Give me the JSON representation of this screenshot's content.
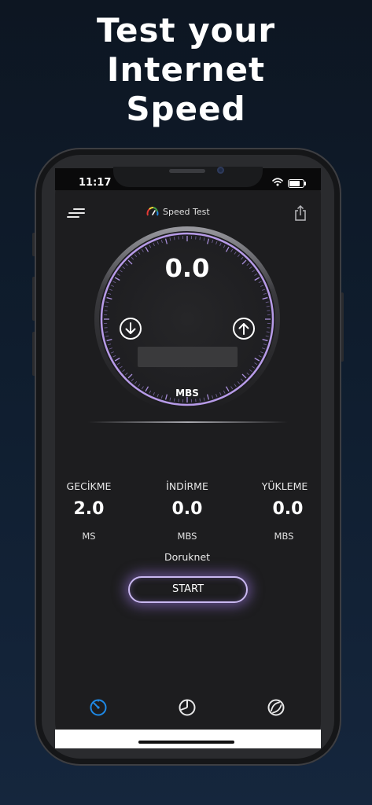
{
  "promo": {
    "line1": "Test your",
    "line2": "Internet",
    "line3": "Speed"
  },
  "status_bar": {
    "time": "11:17",
    "battery_level": 0.85
  },
  "header": {
    "title": "Speed Test",
    "menu_icon": "menu-lines-icon",
    "share_icon": "share-icon"
  },
  "gauge": {
    "speed_value": "0.0",
    "unit": "MBS",
    "download_icon": "arrow-down-circle-icon",
    "upload_icon": "arrow-up-circle-icon"
  },
  "stats": [
    {
      "label": "GECİKME",
      "value": "2.0",
      "unit": "MS"
    },
    {
      "label": "İNDİRME",
      "value": "0.0",
      "unit": "MBS"
    },
    {
      "label": "YÜKLEME",
      "value": "0.0",
      "unit": "MBS"
    }
  ],
  "provider": "Doruknet",
  "start_label": "START",
  "tabs": [
    {
      "icon": "speedometer-icon",
      "active": true
    },
    {
      "icon": "history-icon",
      "active": false
    },
    {
      "icon": "globe-icon",
      "active": false
    }
  ],
  "colors": {
    "accent": "#9d7fe0",
    "active_tab": "#1e88e5",
    "screen_bg": "#1d1d1f"
  }
}
